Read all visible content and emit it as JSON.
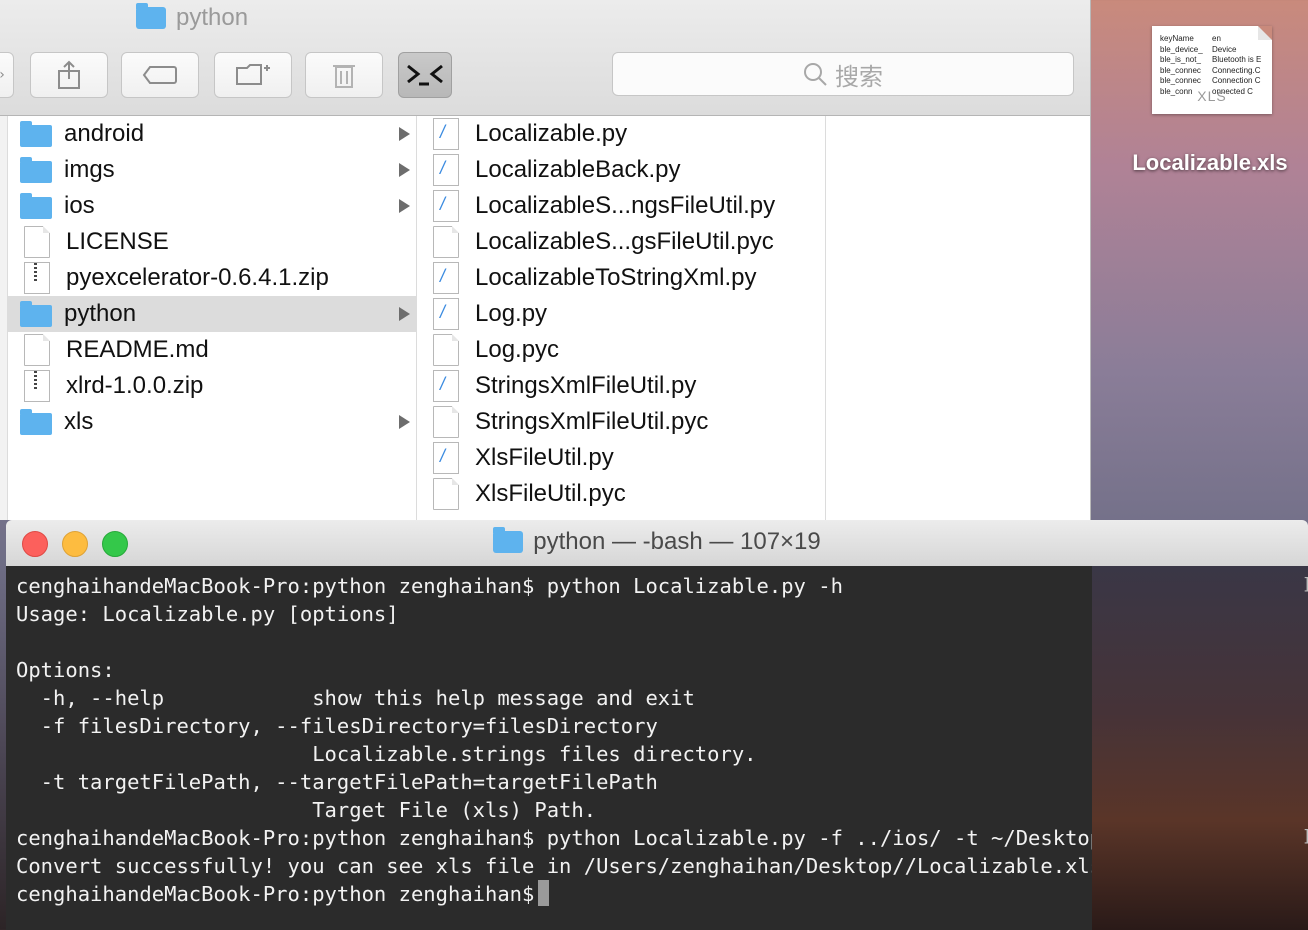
{
  "desktop": {
    "file_label": "Localizable.xls",
    "file_type_tag": "XLS",
    "preview_rows": [
      [
        "keyName",
        "en"
      ],
      [
        "ble_device_",
        "Device"
      ],
      [
        "ble_is_not_",
        "Bluetooth is E"
      ],
      [
        "ble_connec",
        "Connecting.C"
      ],
      [
        "ble_connec",
        "Connection C"
      ],
      [
        "ble_conn",
        "onnected  C"
      ]
    ]
  },
  "finder": {
    "title": "python",
    "search_placeholder": "搜索",
    "column1": [
      {
        "name": "android",
        "type": "folder",
        "has_children": true
      },
      {
        "name": "imgs",
        "type": "folder",
        "has_children": true
      },
      {
        "name": "ios",
        "type": "folder",
        "has_children": true
      },
      {
        "name": "LICENSE",
        "type": "doc",
        "has_children": false
      },
      {
        "name": "pyexcelerator-0.6.4.1.zip",
        "type": "zip",
        "has_children": false
      },
      {
        "name": "python",
        "type": "folder",
        "has_children": true,
        "selected": true
      },
      {
        "name": "README.md",
        "type": "doc",
        "has_children": false
      },
      {
        "name": "xlrd-1.0.0.zip",
        "type": "zip",
        "has_children": false
      },
      {
        "name": "xls",
        "type": "folder",
        "has_children": true
      }
    ],
    "column2": [
      {
        "name": "Localizable.py",
        "type": "py"
      },
      {
        "name": "LocalizableBack.py",
        "type": "py"
      },
      {
        "name": "LocalizableS...ngsFileUtil.py",
        "type": "py"
      },
      {
        "name": "LocalizableS...gsFileUtil.pyc",
        "type": "doc"
      },
      {
        "name": "LocalizableToStringXml.py",
        "type": "py"
      },
      {
        "name": "Log.py",
        "type": "py"
      },
      {
        "name": "Log.pyc",
        "type": "doc"
      },
      {
        "name": "StringsXmlFileUtil.py",
        "type": "py"
      },
      {
        "name": "StringsXmlFileUtil.pyc",
        "type": "doc"
      },
      {
        "name": "XlsFileUtil.py",
        "type": "py"
      },
      {
        "name": "XlsFileUtil.pyc",
        "type": "doc"
      }
    ]
  },
  "terminal": {
    "title": "python — -bash — 107×19",
    "lines": [
      "cenghaihandeMacBook-Pro:python zenghaihan$ python Localizable.py -h",
      "Usage: Localizable.py [options]",
      "",
      "Options:",
      "  -h, --help            show this help message and exit",
      "  -f filesDirectory, --filesDirectory=filesDirectory",
      "                        Localizable.strings files directory.",
      "  -t targetFilePath, --targetFilePath=targetFilePath",
      "                        Target File (xls) Path.",
      "cenghaihandeMacBook-Pro:python zenghaihan$ python Localizable.py -f ../ios/ -t ~/Desktop/",
      "Convert successfully! you can see xls file in /Users/zenghaihan/Desktop//Localizable.xls",
      "cenghaihandeMacBook-Pro:python zenghaihan$"
    ]
  }
}
